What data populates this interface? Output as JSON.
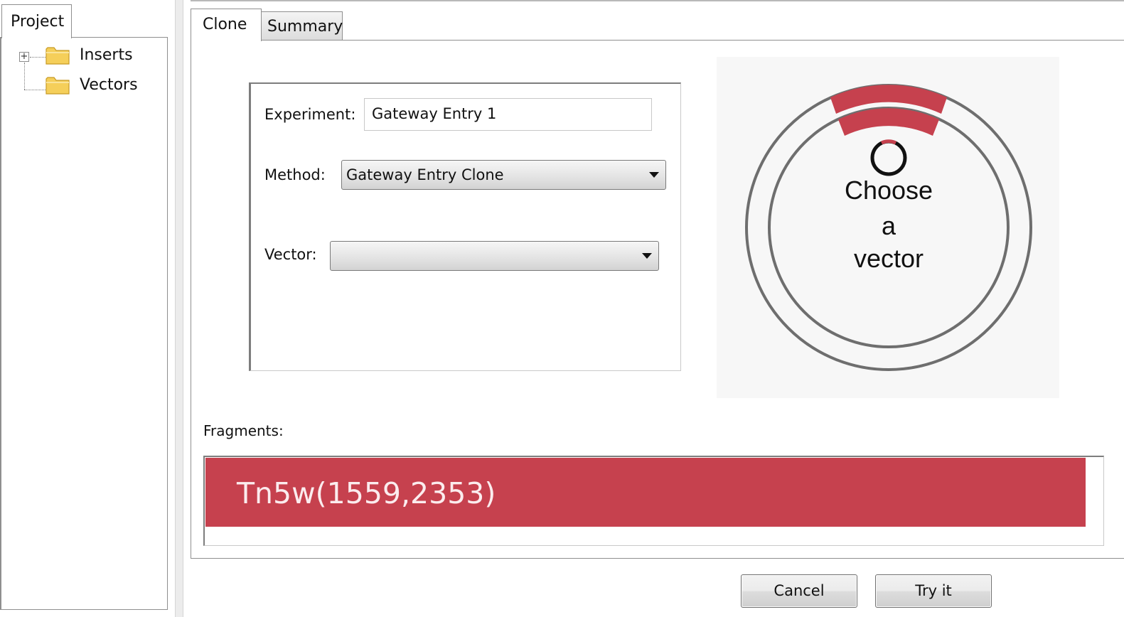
{
  "project_panel": {
    "tab_label": "Project",
    "tree": [
      {
        "label": "Inserts",
        "expandable": true,
        "icon": "folder-icon"
      },
      {
        "label": "Vectors",
        "expandable": false,
        "icon": "folder-icon"
      }
    ],
    "expander_glyph": "+"
  },
  "tabs": [
    {
      "label": "Clone",
      "active": true
    },
    {
      "label": "Summary",
      "active": false
    }
  ],
  "form": {
    "experiment_label": "Experiment:",
    "experiment_value": "Gateway Entry 1",
    "method_label": "Method:",
    "method_value": "Gateway Entry Clone",
    "vector_label": "Vector:",
    "vector_value": ""
  },
  "vector_map": {
    "line1": "Choose",
    "line2": "a",
    "line3": "vector"
  },
  "fragments": {
    "label": "Fragments:",
    "items": [
      {
        "label": "Tn5w(1559,2353)"
      }
    ]
  },
  "buttons": {
    "cancel": "Cancel",
    "try_it": "Try it"
  },
  "colors": {
    "fragment": "#c6414e",
    "map_ring": "#6e6e6e",
    "map_background": "#f7f7f7",
    "folder": "#f5cf5a"
  }
}
